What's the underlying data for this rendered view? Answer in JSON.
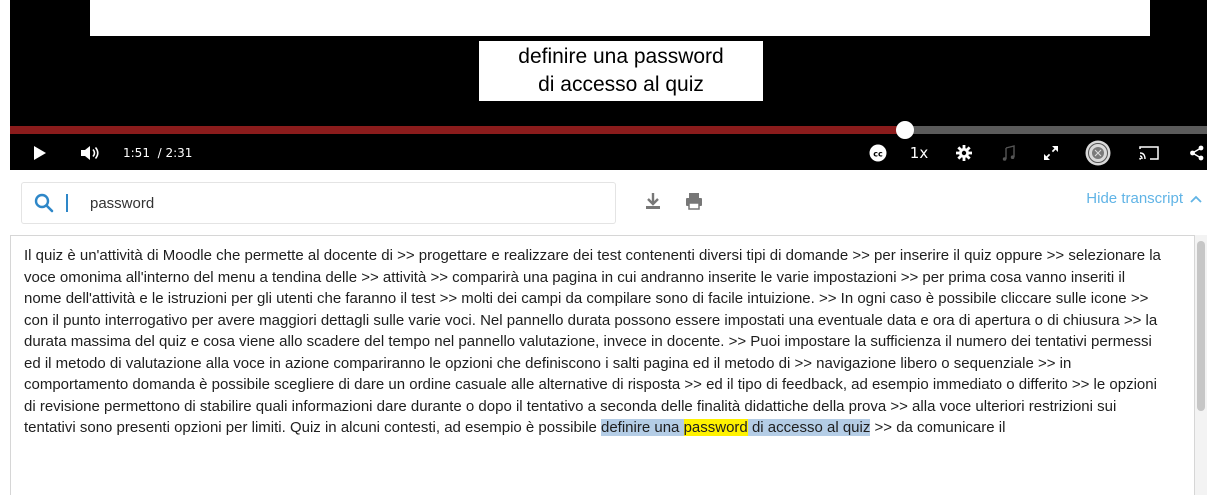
{
  "video": {
    "caption_line1": "definire una password",
    "caption_line2": "di accesso al quiz",
    "progress_fraction": 0.748,
    "current_time": "1:51",
    "total_time": "/ 2:31",
    "speed": "1x"
  },
  "icons": [
    "play-icon",
    "volume-icon",
    "closed-captions-icon",
    "settings-icon",
    "music-note-icon",
    "fullscreen-icon",
    "university-seal-icon",
    "cast-icon",
    "share-icon",
    "search-icon",
    "download-icon",
    "print-icon",
    "chevron-up-icon"
  ],
  "colors": {
    "progress": "#8b1c1c",
    "accent": "#61b4e6",
    "active_segment": "#b4cde6",
    "search_hit": "#fff200"
  },
  "search": {
    "value": "password"
  },
  "toolbar": {
    "hide_transcript": "Hide transcript"
  },
  "transcript": {
    "segments": [
      {
        "text": "Il quiz è un'attività di Moodle che permette al docente di"
      },
      {
        "text": ">> progettare e realizzare dei test contenenti diversi tipi di domande"
      },
      {
        "text": ">> per inserire il quiz oppure"
      },
      {
        "text": ">> selezionare la voce omonima all'interno del menu a tendina delle"
      },
      {
        "text": ">> attività"
      },
      {
        "text": ">> comparirà una pagina in cui andranno inserite le varie impostazioni"
      },
      {
        "text": ">> per prima cosa vanno inseriti il nome dell'attività e le istruzioni per gli utenti che faranno il test"
      },
      {
        "text": ">> molti dei campi da compilare sono di facile intuizione."
      },
      {
        "text": ">> In ogni caso è possibile cliccare sulle icone"
      },
      {
        "text": ">> con il punto interrogativo per avere maggiori dettagli sulle varie voci. Nel pannello durata possono essere impostati una eventuale data e ora di apertura o di chiusura"
      },
      {
        "text": ">> la durata massima del quiz e cosa viene allo scadere del tempo nel pannello valutazione, invece in docente."
      },
      {
        "text": ">> Puoi impostare la sufficienza il numero dei tentativi permessi ed il metodo di valutazione alla voce in azione compariranno le opzioni che definiscono i salti pagina ed il metodo di"
      },
      {
        "text": ">> navigazione libero o sequenziale"
      },
      {
        "text": ">> in comportamento domanda è possibile scegliere di dare un ordine casuale alle alternative di risposta"
      },
      {
        "text": ">> ed il tipo di feedback, ad esempio immediato o differito"
      },
      {
        "text": ">> le opzioni di revisione permettono di stabilire quali informazioni dare durante o dopo il tentativo a seconda delle finalità didattiche della prova"
      },
      {
        "text": ">> alla voce ulteriori restrizioni sui tentativi sono presenti opzioni per limiti. Quiz in alcuni contesti, ad esempio è possibile"
      },
      {
        "pre": "definire una",
        "hit": "password",
        "post": "di accesso al quiz",
        "active": true
      },
      {
        "text": ">> da comunicare il"
      }
    ]
  }
}
